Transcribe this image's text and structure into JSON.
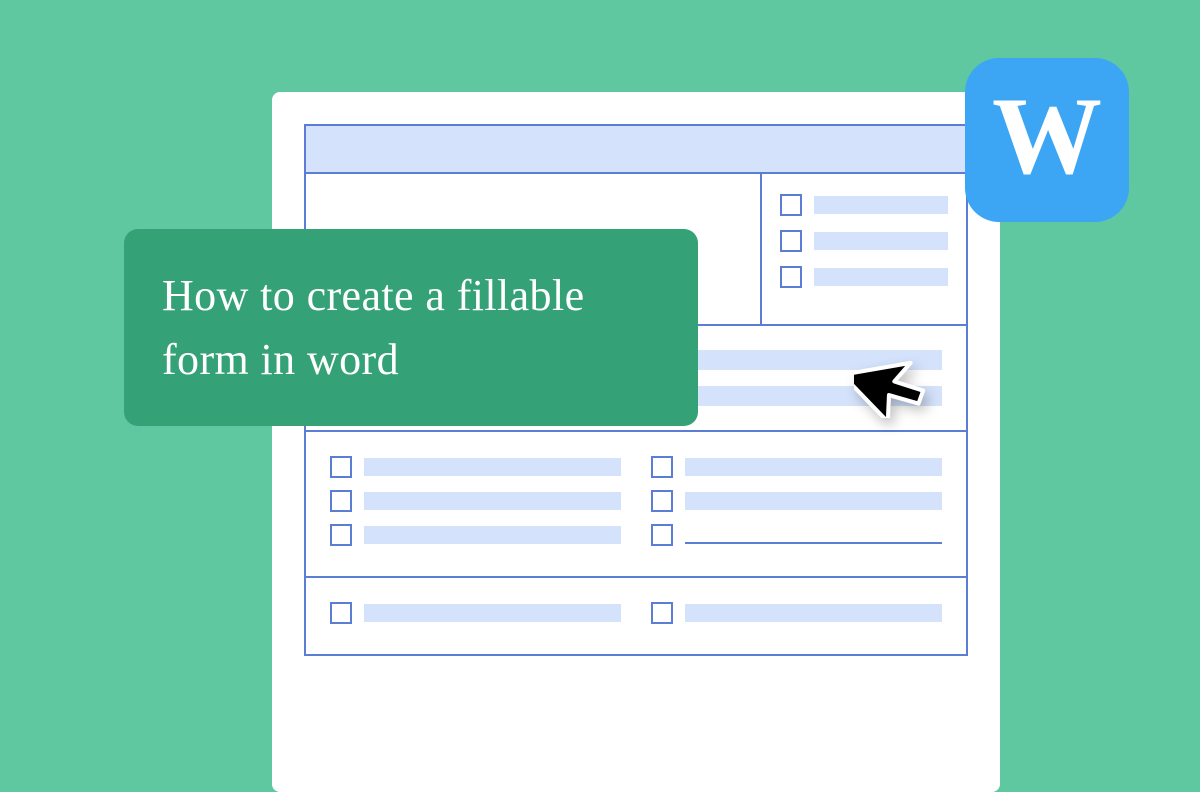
{
  "title": "How to create a fillable form in word",
  "badge": {
    "letter": "W"
  },
  "colors": {
    "background": "#5fc8a0",
    "card": "#34a177",
    "accent": "#3ca6f5",
    "formLine": "#5b7dd6",
    "formFill": "#d4e2fb"
  }
}
